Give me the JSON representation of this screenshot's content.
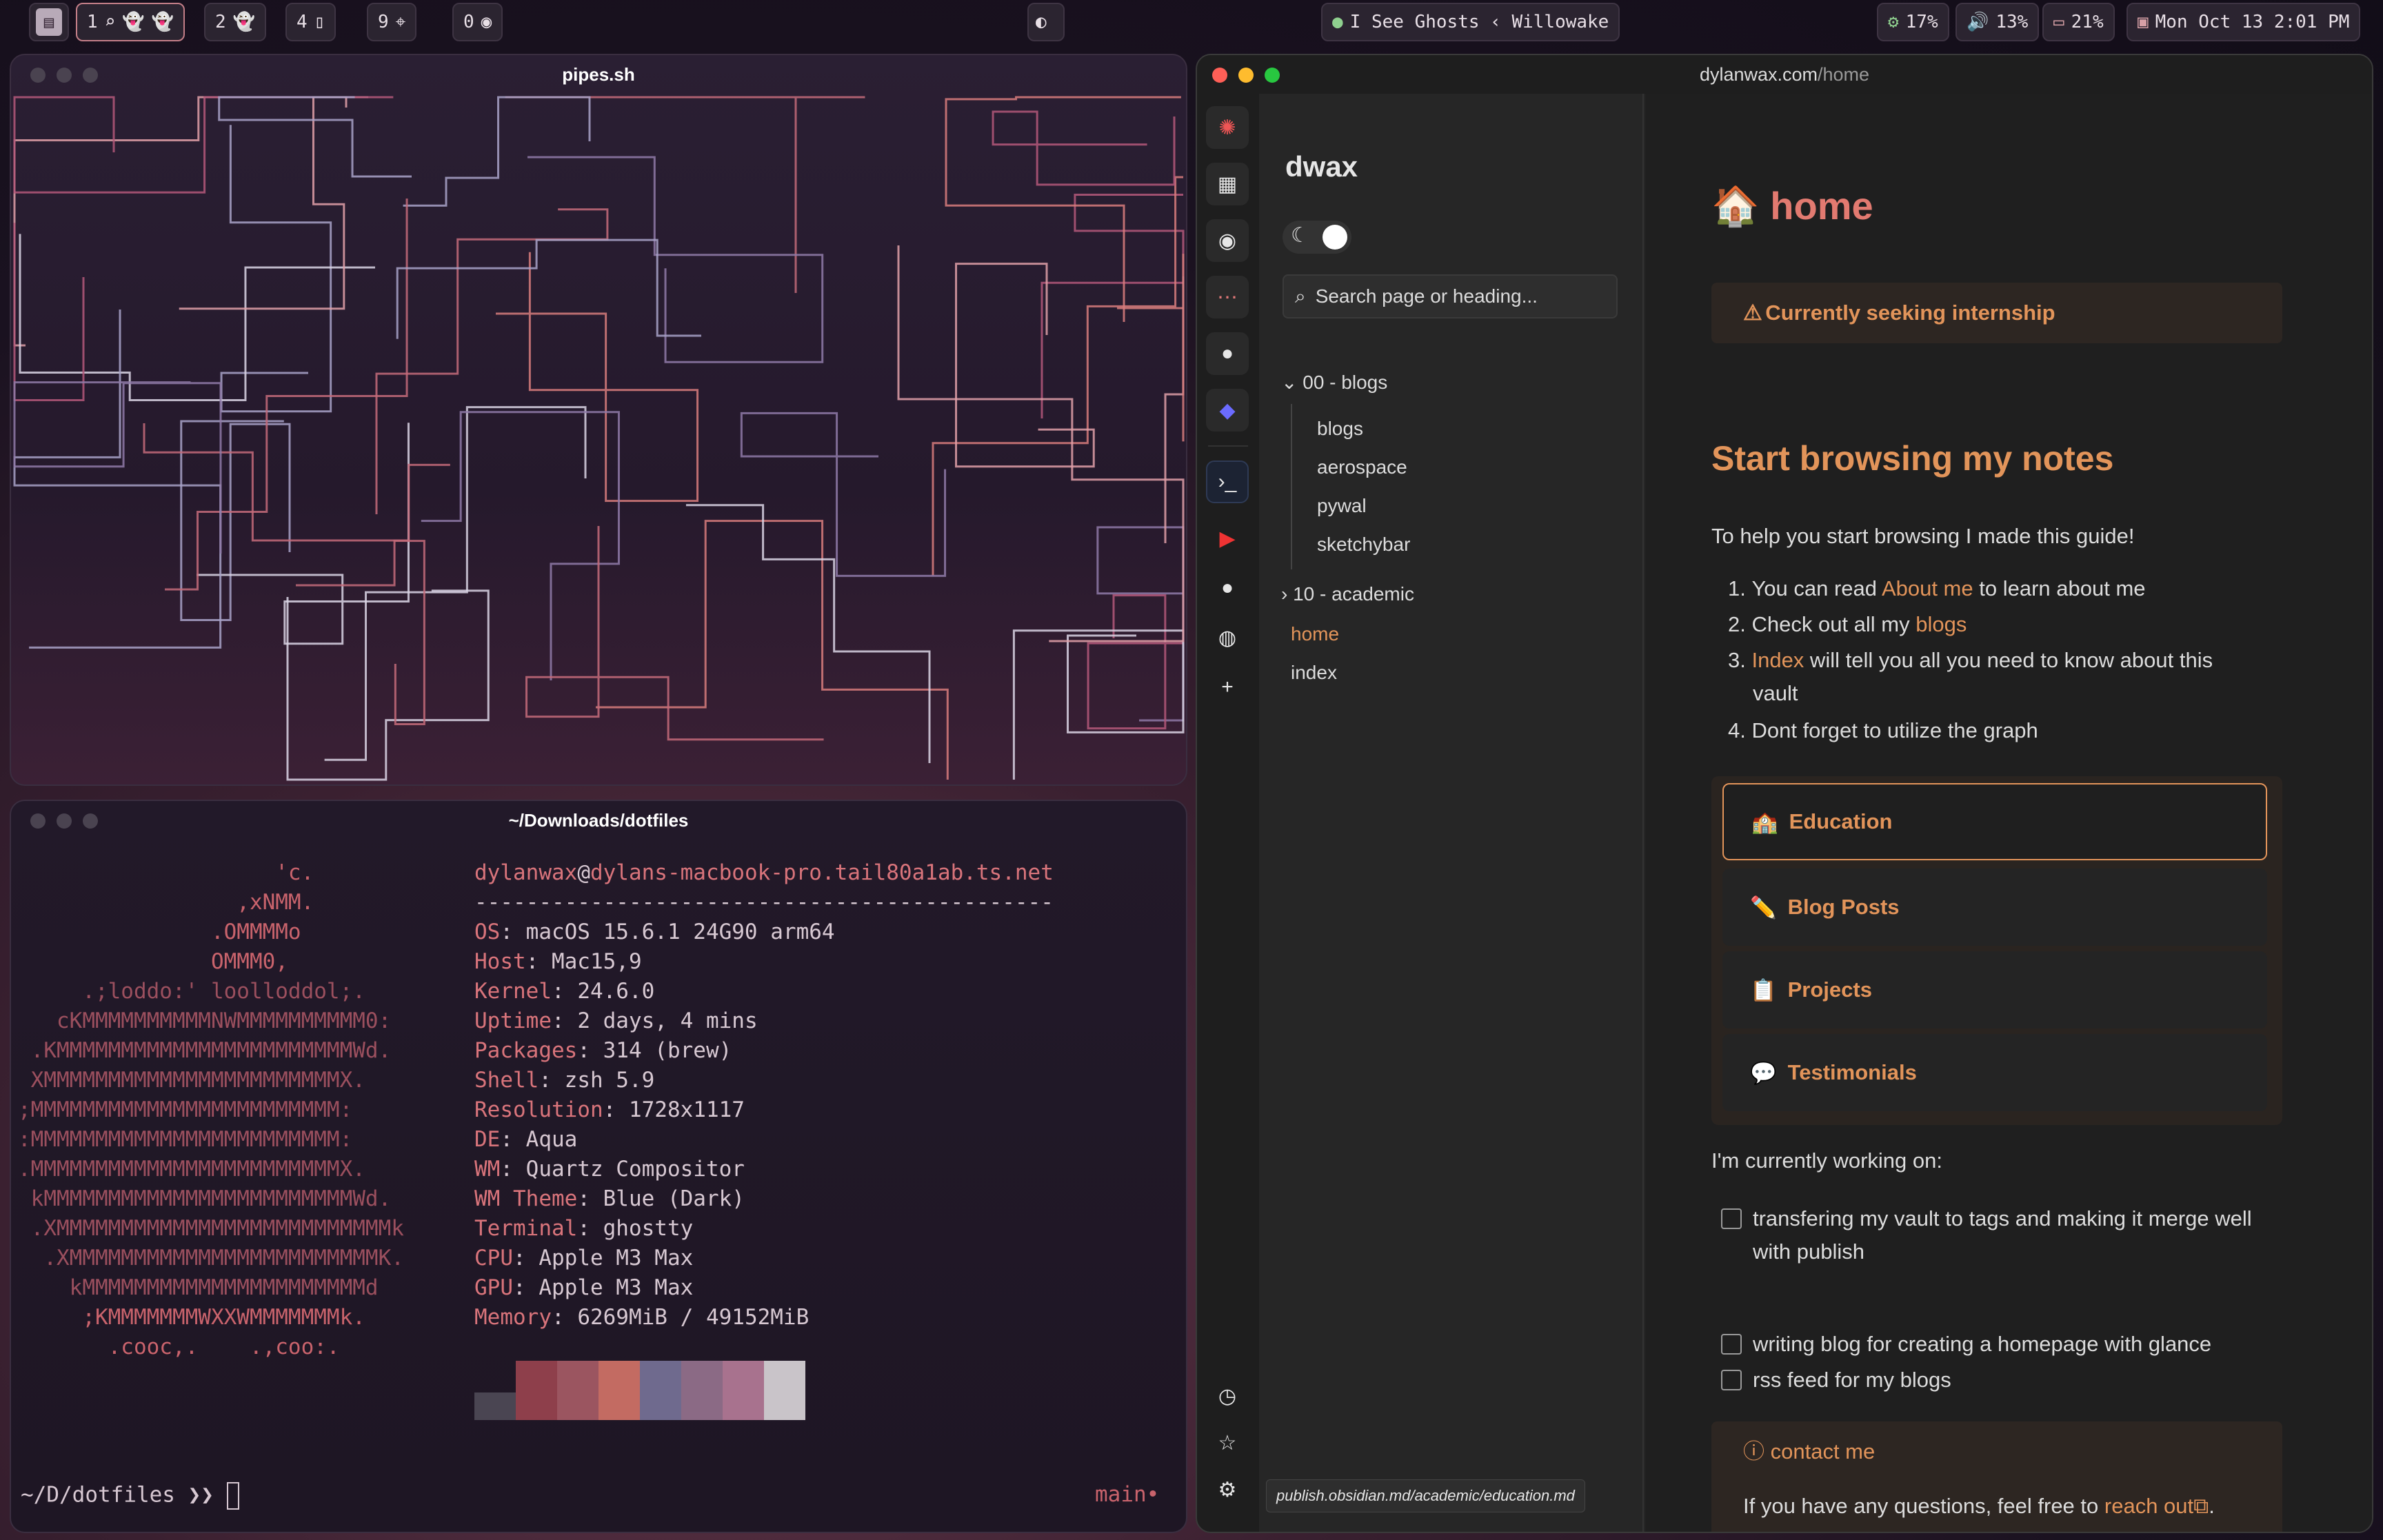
{
  "topbar": {
    "workspaces": [
      {
        "id": "1",
        "icons": [
          "search-icon",
          "ghost-icon",
          "ghost-icon"
        ]
      },
      {
        "id": "2",
        "icons": [
          "ghost-icon"
        ]
      },
      {
        "id": "4",
        "icons": [
          "document-icon"
        ]
      },
      {
        "id": "9",
        "icons": [
          "crosshair-icon"
        ]
      },
      {
        "id": "0",
        "icons": [
          "spotify-icon"
        ]
      }
    ],
    "now_playing": "I See Ghosts ‹ Willowake",
    "cpu": "17%",
    "volume": "13%",
    "battery": "21%",
    "clock": "Mon Oct 13 2:01 PM"
  },
  "pipes_window": {
    "title": "pipes.sh"
  },
  "terminal": {
    "title": "~/Downloads/dotfiles",
    "user_host_user": "dylanwax",
    "user_host_host": "dylans-macbook-pro.tail80a1ab.ts.net",
    "separator": "---------------------------------------------",
    "info": [
      {
        "k": "OS",
        "v": "macOS 15.6.1 24G90 arm64"
      },
      {
        "k": "Host",
        "v": "Mac15,9"
      },
      {
        "k": "Kernel",
        "v": "24.6.0"
      },
      {
        "k": "Uptime",
        "v": "2 days, 4 mins"
      },
      {
        "k": "Packages",
        "v": "314 (brew)"
      },
      {
        "k": "Shell",
        "v": "zsh 5.9"
      },
      {
        "k": "Resolution",
        "v": "1728x1117"
      },
      {
        "k": "DE",
        "v": "Aqua"
      },
      {
        "k": "WM",
        "v": "Quartz Compositor"
      },
      {
        "k": "WM Theme",
        "v": "Blue (Dark)"
      },
      {
        "k": "Terminal",
        "v": "ghostty"
      },
      {
        "k": "CPU",
        "v": "Apple M3 Max"
      },
      {
        "k": "GPU",
        "v": "Apple M3 Max"
      },
      {
        "k": "Memory",
        "v": "6269MiB / 49152MiB"
      }
    ],
    "ascii_art": [
      "                    'c.",
      "                 ,xNMM.",
      "               .OMMMMo",
      "               OMMM0,",
      "     .;loddo:' loolloddol;.",
      "   cKMMMMMMMMMMNWMMMMMMMMMM0:",
      " .KMMMMMMMMMMMMMMMMMMMMMMMWd.",
      " XMMMMMMMMMMMMMMMMMMMMMMMX.",
      ";MMMMMMMMMMMMMMMMMMMMMMMM:",
      ":MMMMMMMMMMMMMMMMMMMMMMMM:",
      ".MMMMMMMMMMMMMMMMMMMMMMMMX.",
      " kMMMMMMMMMMMMMMMMMMMMMMMMWd.",
      " .XMMMMMMMMMMMMMMMMMMMMMMMMMMk",
      "  .XMMMMMMMMMMMMMMMMMMMMMMMMK.",
      "    kMMMMMMMMMMMMMMMMMMMMMMd",
      "     ;KMMMMMMMWXXWMMMMMMMk.",
      "       .cooc,.    .,coo:."
    ],
    "prompt": "~/D/dotfiles ❯❯",
    "git_branch": "main•",
    "palette": [
      "#4a4552",
      "#8e3f4b",
      "#9b5560",
      "#c36b62",
      "#6f6a8e",
      "#8b6a85",
      "#a8728e",
      "#c9c4c9"
    ]
  },
  "browser": {
    "url_host": "dylanwax.com",
    "url_path": "/home",
    "site_title": "dwax",
    "search_placeholder": "Search page or heading...",
    "tree": {
      "folder1": "00 - blogs",
      "folder1_items": [
        "blogs",
        "aerospace",
        "pywal",
        "sketchybar"
      ],
      "folder2": "10 - academic",
      "pages": [
        "home",
        "index"
      ]
    },
    "page": {
      "title": "home",
      "title_emoji": "🏠",
      "notice": "Currently seeking internship",
      "h2": "Start browsing my notes",
      "intro": "To help you start browsing I made this guide!",
      "list": {
        "i1_pre": "You can read ",
        "i1_link": "About me",
        "i1_post": " to learn about me",
        "i2_pre": "Check out all my ",
        "i2_link": "blogs",
        "i3_link": "Index",
        "i3_post1": " will tell you all you need to know about this",
        "i3_post2": "vault",
        "i4": "Dont forget to utilize the graph"
      },
      "cards": [
        {
          "emoji": "🏫",
          "label": "Education"
        },
        {
          "emoji": "✏️",
          "label": "Blog Posts"
        },
        {
          "emoji": "📋",
          "label": "Projects"
        },
        {
          "emoji": "💬",
          "label": "Testimonials"
        }
      ],
      "working_on": "I'm currently working on:",
      "todos": [
        "transfering my vault to tags and making it merge well with publish",
        "writing blog for creating a homepage with glance",
        "rss feed for my blogs"
      ],
      "contact_title": "contact me",
      "contact_pre": "If you have any questions, feel free to ",
      "contact_link": "reach out",
      "contact_post": "."
    },
    "status_url": "publish.obsidian.md/academic/education.md"
  }
}
